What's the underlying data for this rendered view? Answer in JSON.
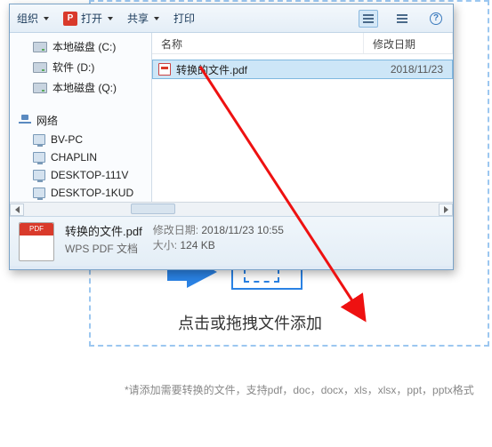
{
  "toolbar": {
    "organize": "组织",
    "open": "打开",
    "share": "共享",
    "print": "打印"
  },
  "tree": {
    "drives": [
      {
        "label": "本地磁盘 (C:)"
      },
      {
        "label": "软件 (D:)"
      },
      {
        "label": "本地磁盘 (Q:)"
      }
    ],
    "network_label": "网络",
    "computers": [
      {
        "label": "BV-PC"
      },
      {
        "label": "CHAPLIN"
      },
      {
        "label": "DESKTOP-111V"
      },
      {
        "label": "DESKTOP-1KUD"
      }
    ]
  },
  "filelist": {
    "columns": {
      "name": "名称",
      "date": "修改日期"
    },
    "row": {
      "name": "转换的文件.pdf",
      "date": "2018/11/23"
    }
  },
  "details": {
    "filename": "转换的文件.pdf",
    "filetype": "WPS PDF 文档",
    "date_label": "修改日期:",
    "date_value": "2018/11/23 10:55",
    "size_label": "大小:",
    "size_value": "124 KB"
  },
  "drop": {
    "text": "点击或拖拽文件添加",
    "hint": "*请添加需要转换的文件，支持pdf，doc，docx，xls，xlsx，ppt，pptx格式"
  },
  "icons": {
    "help": "?"
  }
}
